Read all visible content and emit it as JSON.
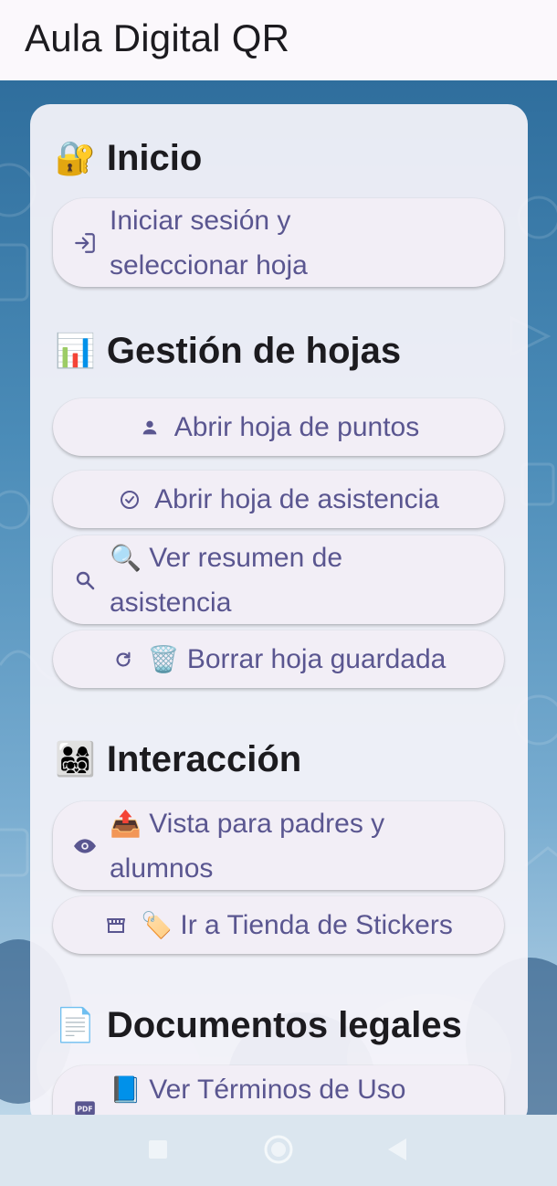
{
  "app": {
    "title": "Aula Digital QR"
  },
  "sections": {
    "inicio": {
      "emoji": "🔐",
      "title": "Inicio"
    },
    "gestion": {
      "emoji": "📊",
      "title": "Gestión de hojas"
    },
    "interaccion": {
      "emoji": "👨‍👩‍👧‍👦",
      "title": "Interacción"
    },
    "legales": {
      "emoji": "📄",
      "title": "Documentos legales"
    }
  },
  "buttons": {
    "login": {
      "icon": "login-icon",
      "line1": "Iniciar sesión y",
      "line2": "seleccionar hoja"
    },
    "points": {
      "icon": "person-icon",
      "label": "Abrir hoja de puntos"
    },
    "attendance": {
      "icon": "check-circle-icon",
      "label": "Abrir hoja de asistencia"
    },
    "summary": {
      "icon": "search-icon",
      "emoji": "🔍",
      "line1": "Ver resumen de",
      "line2": "asistencia"
    },
    "delete": {
      "icon": "refresh-icon",
      "emoji": "🗑️",
      "label": "Borrar hoja guardada"
    },
    "parents": {
      "icon": "eye-icon",
      "emoji": "📤",
      "line1": "Vista para padres y",
      "line2": "alumnos"
    },
    "store": {
      "icon": "store-icon",
      "emoji": "🏷️",
      "label": "Ir a Tienda de Stickers"
    },
    "terms": {
      "icon": "pdf-icon",
      "emoji": "📘",
      "label": "Ver Términos de Uso"
    }
  },
  "navbar": {
    "icons": [
      "recent-apps-icon",
      "home-icon",
      "back-icon"
    ]
  },
  "colors": {
    "accent_text": "#5a5690",
    "button_bg": "#f2eef6",
    "background_top": "#2f6e9d",
    "background_bottom": "#bcd6e8"
  }
}
